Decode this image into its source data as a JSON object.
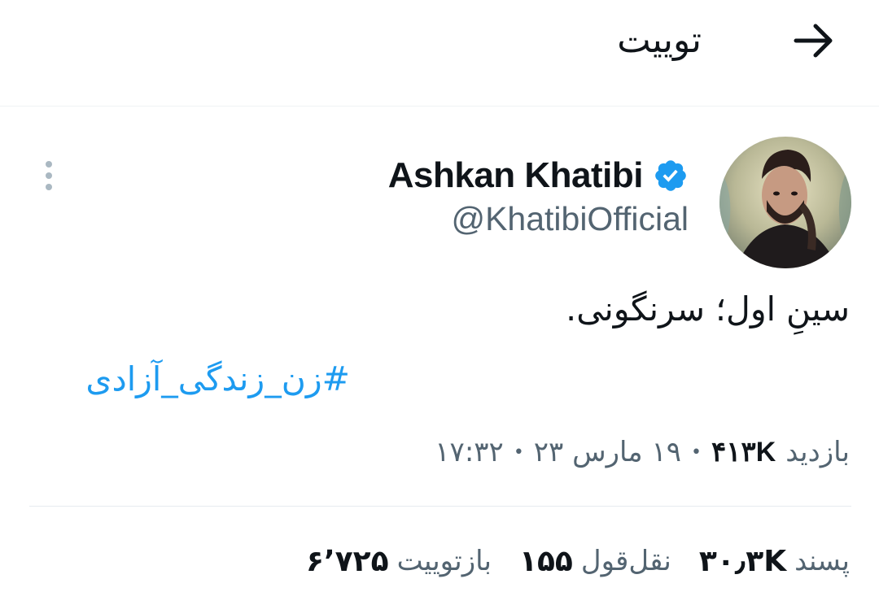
{
  "header": {
    "title": "توییت",
    "back_icon": "arrow-right-icon"
  },
  "author": {
    "name": "Ashkan Khatibi",
    "handle": "@KhatibiOfficial",
    "verified_color": "#1d9bf0"
  },
  "tweet": {
    "text": "سینِ اول؛ سرنگونی.",
    "hashtag": "#زن_زندگی_آزادی"
  },
  "meta": {
    "time": "۱۷:۳۲",
    "date": "۱۹ مارس ۲۳",
    "views_count": "۴۱۳K",
    "views_label": "بازدید"
  },
  "stats": {
    "retweets_count": "۶٬۷۲۵",
    "retweets_label": "بازتوییت",
    "quotes_count": "۱۵۵",
    "quotes_label": "نقل‌قول",
    "likes_count": "۳۰٫۳K",
    "likes_label": "پسند"
  },
  "colors": {
    "accent": "#1d9bf0",
    "secondary_text": "#536471",
    "divider": "#eff3f4"
  }
}
